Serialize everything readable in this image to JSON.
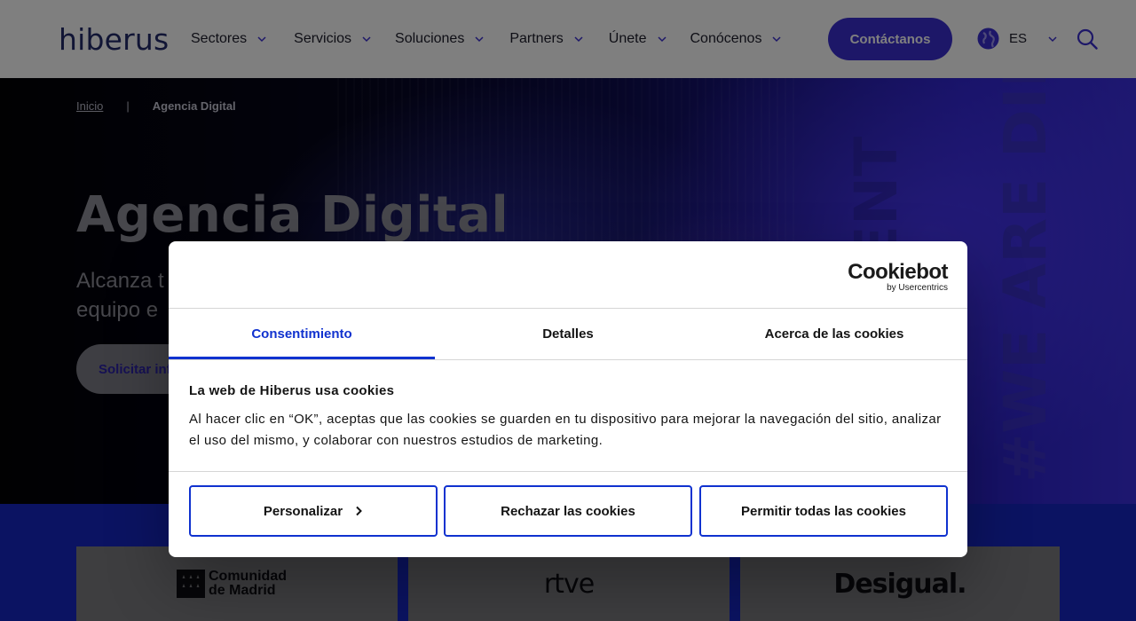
{
  "header": {
    "logo": "hiberus",
    "nav": [
      {
        "label": "Sectores"
      },
      {
        "label": "Servicios"
      },
      {
        "label": "Soluciones"
      },
      {
        "label": "Partners"
      },
      {
        "label": "Únete"
      },
      {
        "label": "Conócenos"
      }
    ],
    "contact_label": "Contáctanos",
    "language": "ES",
    "icons": {
      "globe": "globe-icon",
      "search": "search-icon",
      "chevron": "chevron-down-icon"
    }
  },
  "hero": {
    "breadcrumb": {
      "home": "Inicio",
      "separator": "|",
      "current": "Agencia Digital"
    },
    "title": "Agencia Digital",
    "subtitle_line1": "Alcanza t",
    "subtitle_line2": "equipo e",
    "cta_label": "Solicitar inf",
    "vertical_text_1": "#WE ARE DIFFERENT",
    "vertical_text_2": "RE ENT"
  },
  "clients": [
    "Comunidad de Madrid",
    "rtve",
    "Desigual."
  ],
  "cookie_dialog": {
    "brand": "Cookiebot",
    "brand_sub": "by Usercentrics",
    "tabs": [
      {
        "label": "Consentimiento",
        "active": true
      },
      {
        "label": "Detalles",
        "active": false
      },
      {
        "label": "Acerca de las cookies",
        "active": false
      }
    ],
    "heading": "La web de Hiberus usa cookies",
    "text": "Al hacer clic en “OK”, aceptas que las cookies se guarden en tu dispositivo para mejorar la navegación del sitio, analizar el uso del mismo, y colaborar con nuestros estudios de marketing.",
    "buttons": {
      "customize": "Personalizar",
      "reject": "Rechazar las cookies",
      "accept_all": "Permitir todas las cookies"
    }
  },
  "colors": {
    "brand_navy": "#232b6b",
    "accent_purple": "#3b2fd0",
    "cookiebot_blue": "#1032cf",
    "client_strip_blue": "#1626c4"
  }
}
